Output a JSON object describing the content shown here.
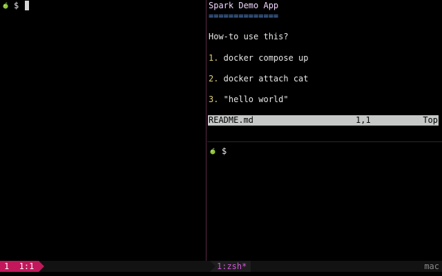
{
  "left_pane": {
    "prompt_symbol": "$",
    "prompt_icon": "apple-icon"
  },
  "vim": {
    "title": "Spark Demo App",
    "title_underline": "==============",
    "heading": "How-to use this?",
    "steps": [
      {
        "num": "1.",
        "text": " docker compose up"
      },
      {
        "num": "2.",
        "text": " docker attach cat"
      },
      {
        "num": "3.",
        "text": " \"hello world\""
      }
    ],
    "status": {
      "filename": "README.md",
      "position": "1,1",
      "scroll": "Top"
    }
  },
  "right_bottom_pane": {
    "prompt_symbol": "$",
    "prompt_icon": "apple-icon"
  },
  "tmux": {
    "session": "1  1:1",
    "window": "1:zsh*",
    "host": "mac"
  },
  "colors": {
    "accent": "#c2185b",
    "window_label": "#d05ad8",
    "vim_status_bg": "#c5c8c6",
    "divider": "#5a2a46"
  }
}
